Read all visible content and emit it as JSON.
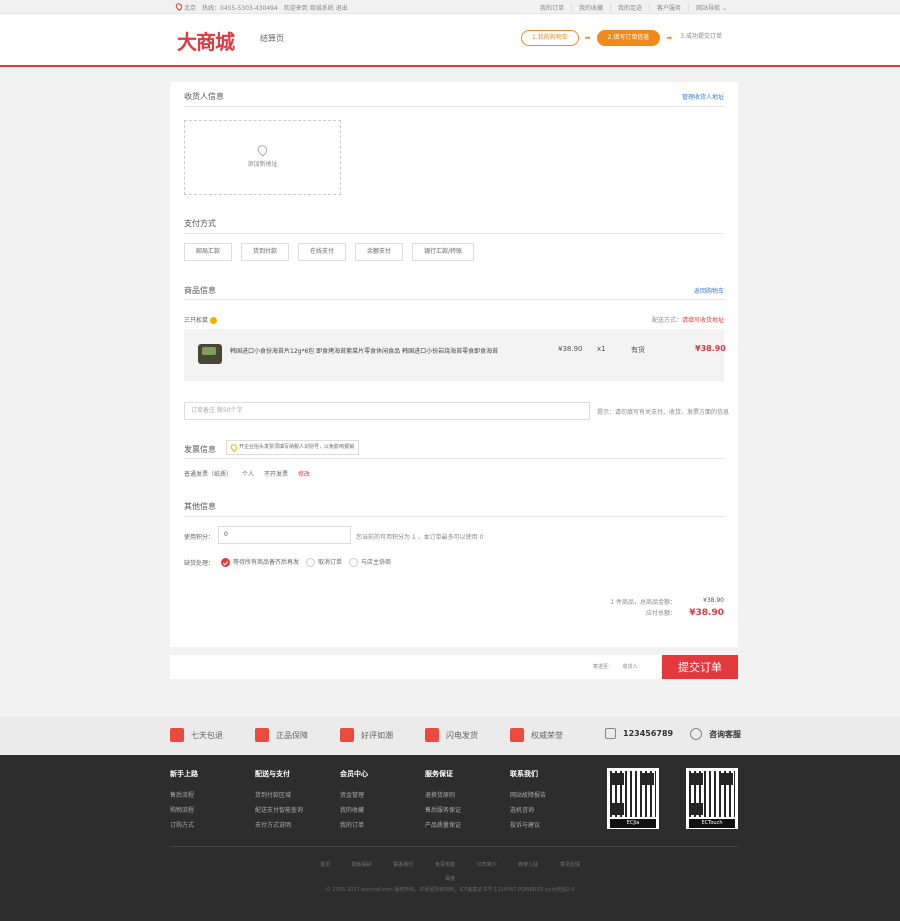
{
  "topbar": {
    "city": "北京",
    "phone": "热线：0455-5303-430494",
    "welcome": "欢迎来到 商城系统 退出",
    "links": [
      "我的订单",
      "我的收藏",
      "我的足迹",
      "客户服务",
      "网站导航 ⌄"
    ]
  },
  "header": {
    "logo": "大商城",
    "page_name": "结算页",
    "steps": [
      "1.我的购物车",
      "2.填写订单信息",
      "3.成功提交订单"
    ]
  },
  "consignee": {
    "title": "收货人信息",
    "manage_link": "管理收货人地址",
    "add_label": "添加新地址"
  },
  "payment": {
    "title": "支付方式",
    "options": [
      "邮局汇款",
      "货到付款",
      "在线支付",
      "余额支付",
      "银行汇款/转账"
    ]
  },
  "goods": {
    "title": "商品信息",
    "back_link": "返回购物车",
    "shop": "三只松鼠",
    "shipping_label": "配送方式：",
    "shipping_value": "请填写收货地址",
    "item": {
      "name": "韩国进口小食份海苔片12g*6包 即食烤海苔紫菜片零食休闲食品 韩国进口小份岩烧海苔零食即食海苔",
      "price": "¥38.90",
      "qty": "x1",
      "stock": "有货",
      "subtotal": "¥38.90"
    }
  },
  "note": {
    "placeholder": "订单备注 限50个字",
    "tip": "提示：请勿填写有关支付、收货、发票方面的信息"
  },
  "invoice": {
    "title": "发票信息",
    "tip": "开企业抬头发票须填写纳税人识别号，以免影响报销",
    "type": "普通发票（纸质）",
    "holder": "个人",
    "content": "不开发票",
    "modify": "修改"
  },
  "other": {
    "title": "其他信息",
    "points_label": "使用积分：",
    "points_value": "0",
    "points_tip": "您当前的可用积分为 1 ，本订单最多可以使用 0",
    "oos_label": "缺货处理：",
    "oos_options": [
      "等待所有商品备齐后再发",
      "取消订单",
      "与店主协商"
    ]
  },
  "summary": {
    "count_label": "1 件商品，总商品金额：",
    "count_value": "¥38.90",
    "payable_label": "应付总额：",
    "payable_value": "¥38.90"
  },
  "submit": {
    "ship_to": "寄送至：",
    "receiver": "收货人：",
    "button": "提交订单"
  },
  "services": [
    "七天包退",
    "正品保障",
    "好评如潮",
    "闪电发货",
    "权威荣誉"
  ],
  "service_phone": "123456789",
  "service_chat": "咨询客服",
  "footer": {
    "cols": [
      {
        "title": "新手上路",
        "items": [
          "售后流程",
          "购物流程",
          "订购方式"
        ]
      },
      {
        "title": "配送与支付",
        "items": [
          "货到付款区域",
          "配送支付智能查询",
          "支付方式说明"
        ]
      },
      {
        "title": "会员中心",
        "items": [
          "资金管理",
          "我的收藏",
          "我的订单"
        ]
      },
      {
        "title": "服务保证",
        "items": [
          "退换货原则",
          "售后服务保证",
          "产品质量保证"
        ]
      },
      {
        "title": "联系我们",
        "items": [
          "网站故障报告",
          "选机咨询",
          "投诉与建议"
        ]
      }
    ],
    "qr_labels": [
      "ECJia",
      "ECTouch"
    ],
    "links": [
      "首页",
      "隐私保护",
      "联系我们",
      "免责条款",
      "公司简介",
      "商家入驻",
      "意见反馈"
    ],
    "help": "百度",
    "copyright": "© 2005-2017 dscmall.com 版权所有，并保留所有权利。ICP备案证书号:1234567 POWERED by大商创2.0"
  }
}
